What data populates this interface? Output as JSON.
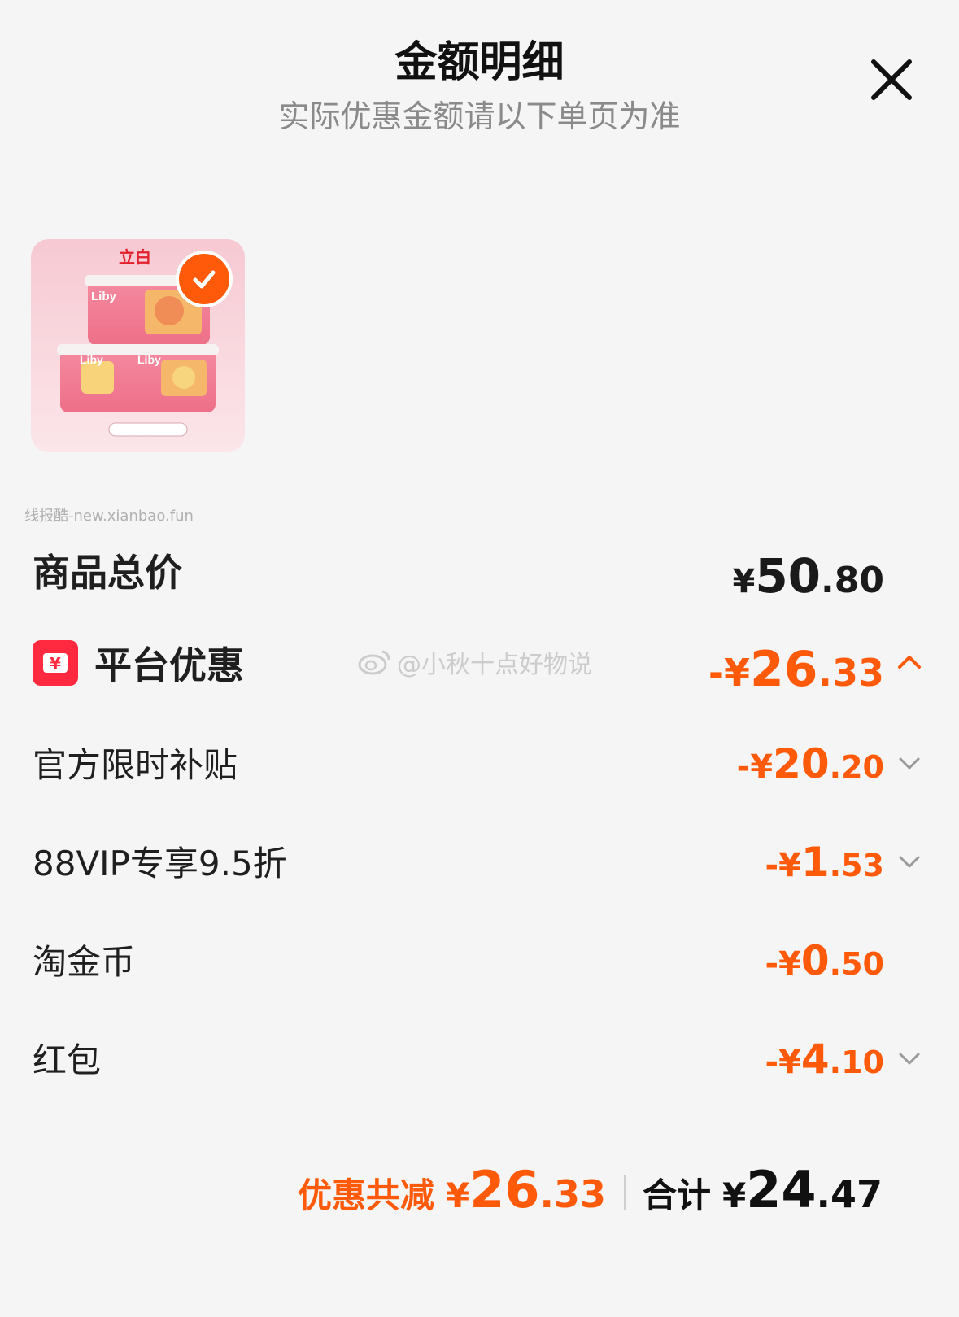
{
  "header": {
    "title": "金额明细",
    "subtitle": "实际优惠金额请以下单页为准"
  },
  "product": {
    "brand_text": "立白",
    "logo_text": "Liby",
    "selected": true
  },
  "watermarks": {
    "site": "线报酷-new.xianbao.fun",
    "weibo": "@小秋十点好物说"
  },
  "rows": {
    "total": {
      "label": "商品总价",
      "prefix": "¥",
      "int": "50",
      "dec": ".80"
    },
    "platform": {
      "label": "平台优惠",
      "icon_symbol": "¥",
      "prefix": "-¥",
      "int": "26",
      "dec": ".33"
    },
    "subsidy": {
      "label": "官方限时补贴",
      "prefix": "-¥",
      "int": "20",
      "dec": ".20"
    },
    "vip": {
      "label": "88VIP专享9.5折",
      "prefix": "-¥",
      "int": "1",
      "dec": ".53"
    },
    "coin": {
      "label": "淘金币",
      "prefix": "-¥",
      "int": "0",
      "dec": ".50"
    },
    "redpacket": {
      "label": "红包",
      "prefix": "-¥",
      "int": "4",
      "dec": ".10"
    }
  },
  "summary": {
    "discount_label": "优惠共减",
    "discount_prefix": "¥",
    "discount_int": "26",
    "discount_dec": ".33",
    "total_label": "合计",
    "total_prefix": "¥",
    "total_int": "24",
    "total_dec": ".47"
  },
  "colors": {
    "accent": "#ff5a0a",
    "platform_icon": "#ff2a3f",
    "background": "#f5f5f5"
  }
}
